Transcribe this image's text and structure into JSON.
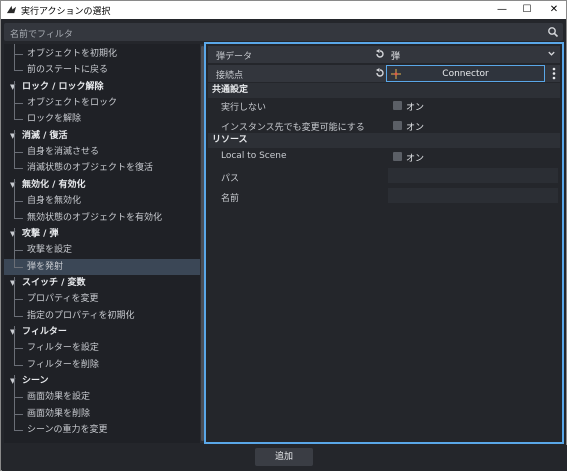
{
  "window": {
    "title": "実行アクションの選択",
    "controls": {
      "minimize": "—",
      "maximize": "☐",
      "close": "✕"
    }
  },
  "filter": {
    "placeholder": "名前でフィルタ"
  },
  "tree": [
    {
      "type": "item",
      "label": "オブジェクトを初期化"
    },
    {
      "type": "item",
      "label": "前のステートに戻る"
    },
    {
      "type": "cat",
      "label": "ロック / ロック解除"
    },
    {
      "type": "item",
      "label": "オブジェクトをロック"
    },
    {
      "type": "item",
      "label": "ロックを解除"
    },
    {
      "type": "cat",
      "label": "消滅 / 復活"
    },
    {
      "type": "item",
      "label": "自身を消滅させる"
    },
    {
      "type": "item",
      "label": "消滅状態のオブジェクトを復活"
    },
    {
      "type": "cat",
      "label": "無効化 / 有効化"
    },
    {
      "type": "item",
      "label": "自身を無効化"
    },
    {
      "type": "item",
      "label": "無効状態のオブジェクトを有効化"
    },
    {
      "type": "cat",
      "label": "攻撃 / 弾"
    },
    {
      "type": "item",
      "label": "攻撃を設定"
    },
    {
      "type": "item",
      "label": "弾を発射",
      "selected": true
    },
    {
      "type": "cat",
      "label": "スイッチ / 変数"
    },
    {
      "type": "item",
      "label": "プロパティを変更"
    },
    {
      "type": "item",
      "label": "指定のプロパティを初期化"
    },
    {
      "type": "cat",
      "label": "フィルター"
    },
    {
      "type": "item",
      "label": "フィルターを設定"
    },
    {
      "type": "item",
      "label": "フィルターを削除"
    },
    {
      "type": "cat",
      "label": "シーン"
    },
    {
      "type": "item",
      "label": "画面効果を設定"
    },
    {
      "type": "item",
      "label": "画面効果を削除"
    },
    {
      "type": "item",
      "label": "シーンの重力を変更"
    }
  ],
  "inspector": {
    "bullet_data": {
      "label": "弾データ",
      "value": "弾"
    },
    "connection_point": {
      "label": "接続点",
      "value": "Connector"
    },
    "common_section": "共通設定",
    "no_execute": {
      "label": "実行しない",
      "check_label": "オン"
    },
    "instance_editable": {
      "label": "インスタンス先でも変更可能にする",
      "check_label": "オン"
    },
    "resource_section": "リソース",
    "local_to_scene": {
      "label": "Local to Scene",
      "check_label": "オン"
    },
    "path": {
      "label": "パス",
      "value": ""
    },
    "name": {
      "label": "名前",
      "value": ""
    }
  },
  "footer": {
    "add_label": "追加"
  },
  "colors": {
    "accent": "#5aa7e8",
    "selection": "#3b4756",
    "background": "#24262b"
  }
}
